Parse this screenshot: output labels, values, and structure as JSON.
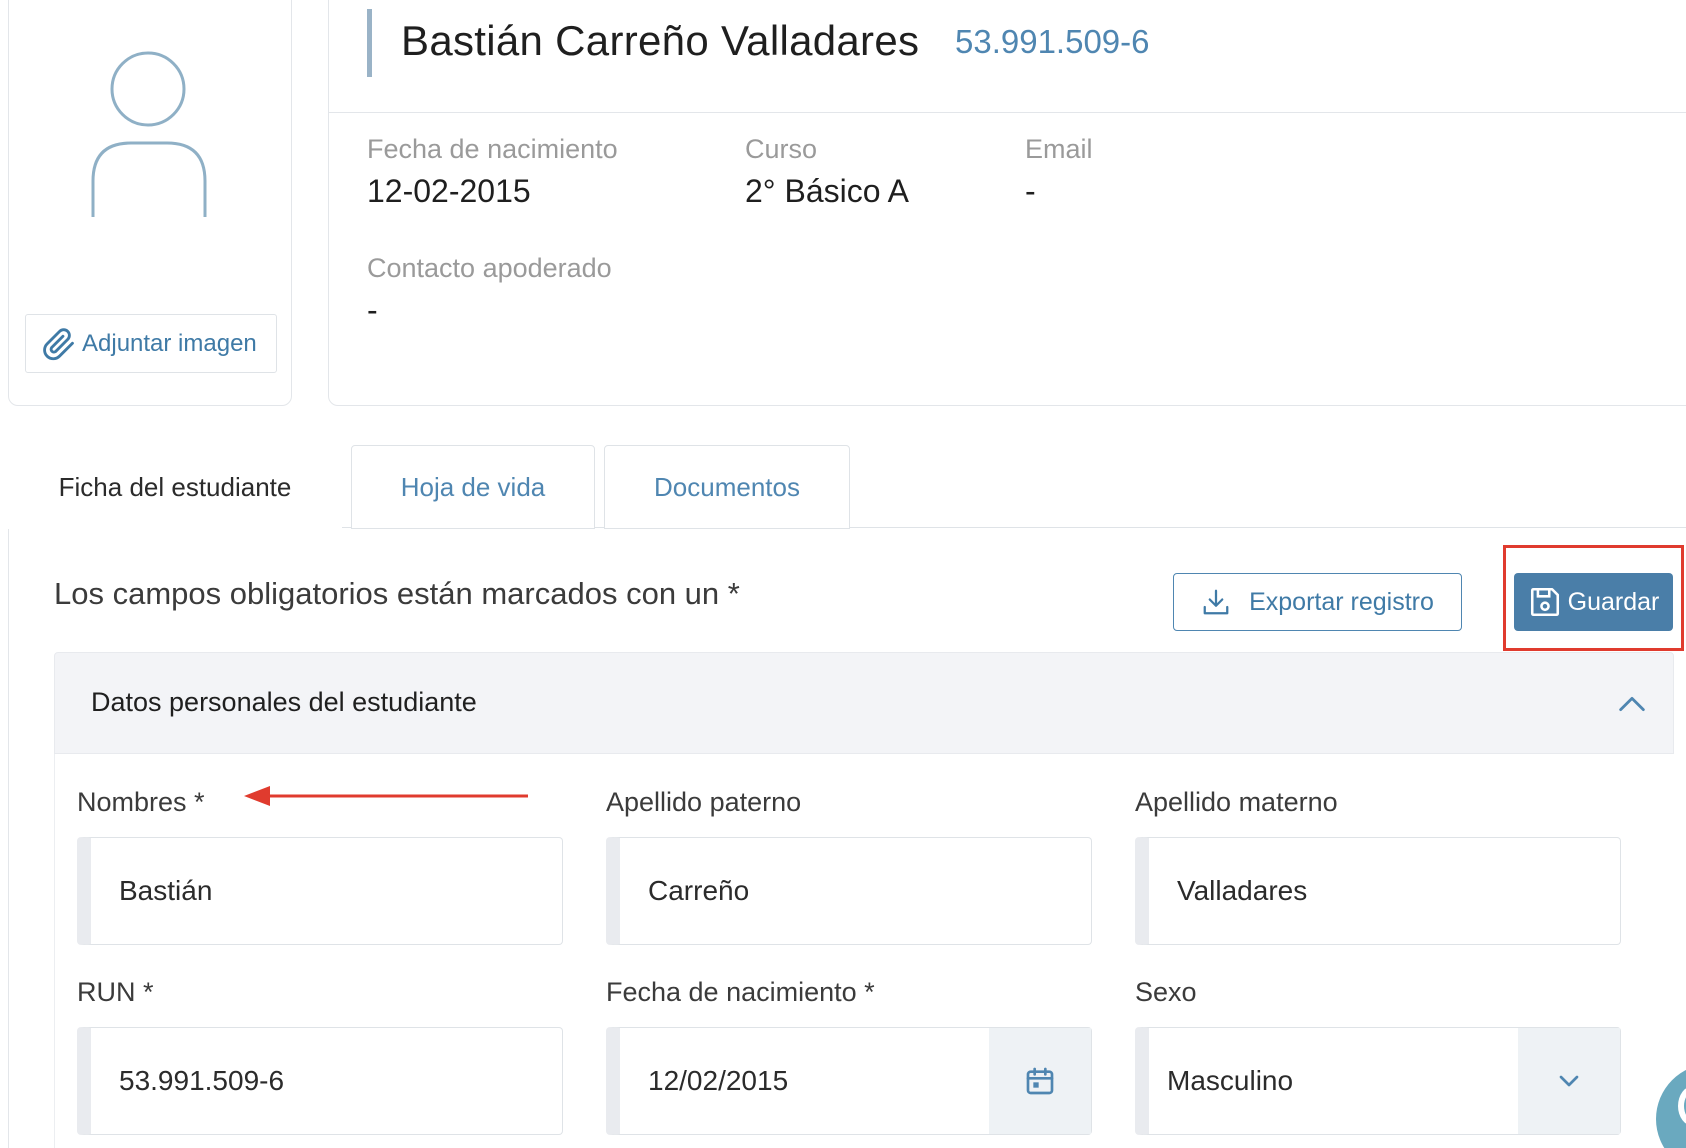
{
  "avatar": {
    "icon": "user-icon",
    "attach_label": "Adjuntar imagen",
    "attach_icon": "paperclip-icon"
  },
  "profile": {
    "name": "Bastián Carreño Valladares",
    "run": "53.991.509-6",
    "fields": [
      {
        "label": "Fecha de nacimiento",
        "value": "12-02-2015"
      },
      {
        "label": "Curso",
        "value": "2° Básico A"
      },
      {
        "label": "Email",
        "value": "-"
      },
      {
        "label": "Contacto apoderado",
        "value": "-"
      }
    ]
  },
  "tabs": [
    {
      "label": "Ficha del estudiante",
      "active": true
    },
    {
      "label": "Hoja de vida",
      "active": false
    },
    {
      "label": "Documentos",
      "active": false
    }
  ],
  "toolbar": {
    "required_note": "Los campos obligatorios están marcados con un *",
    "export_label": "Exportar registro",
    "export_icon": "download-icon",
    "save_label": "Guardar",
    "save_icon": "floppy-disk-icon"
  },
  "section": {
    "title": "Datos personales del estudiante",
    "toggle_icon": "chevron-up-icon",
    "fields": [
      {
        "label": "Nombres *",
        "value": "Bastián"
      },
      {
        "label": "Apellido paterno",
        "value": "Carreño"
      },
      {
        "label": "Apellido materno",
        "value": "Valladares"
      },
      {
        "label": "RUN *",
        "value": "53.991.509-6"
      },
      {
        "label": "Fecha de nacimiento *",
        "value": "12/02/2015",
        "addon_icon": "calendar-icon"
      },
      {
        "label": "Sexo",
        "value": "Masculino",
        "addon_icon": "chevron-down-icon"
      }
    ]
  },
  "colors": {
    "accent": "#4a7ea8",
    "link": "#4f86b1",
    "annotation": "#e03b2e"
  }
}
